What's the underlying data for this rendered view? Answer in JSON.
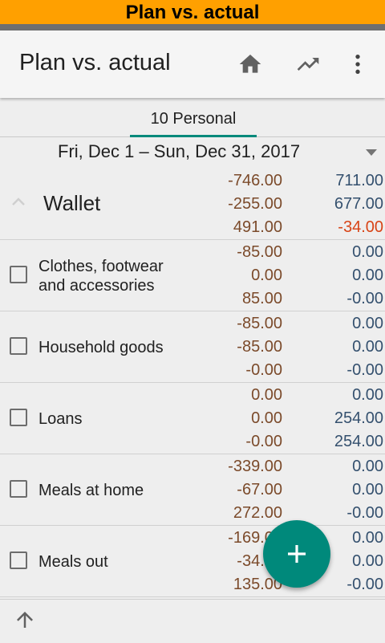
{
  "banner": {
    "title": "Plan vs. actual"
  },
  "appbar": {
    "title": "Plan vs. actual",
    "icons": [
      "home-icon",
      "trending-up-icon",
      "more-vert-icon"
    ]
  },
  "tabs": [
    {
      "label": "10 Personal",
      "selected": true
    }
  ],
  "date_range": {
    "label": "Fri, Dec 1 – Sun, Dec 31, 2017"
  },
  "wallet": {
    "label": "Wallet",
    "col1": [
      "-746.00",
      "-255.00",
      "491.00"
    ],
    "col2": [
      "711.00",
      "677.00",
      "-34.00"
    ]
  },
  "categories": [
    {
      "label_line1": "Clothes, footwear",
      "label_line2": "and accessories",
      "col1": [
        "-85.00",
        "0.00",
        "85.00"
      ],
      "col2": [
        "0.00",
        "0.00",
        "-0.00"
      ]
    },
    {
      "label_line1": "Household goods",
      "label_line2": "",
      "col1": [
        "-85.00",
        "-85.00",
        "-0.00"
      ],
      "col2": [
        "0.00",
        "0.00",
        "-0.00"
      ]
    },
    {
      "label_line1": "Loans",
      "label_line2": "",
      "col1": [
        "0.00",
        "0.00",
        "-0.00"
      ],
      "col2": [
        "0.00",
        "254.00",
        "254.00"
      ]
    },
    {
      "label_line1": "Meals at home",
      "label_line2": "",
      "col1": [
        "-339.00",
        "-67.00",
        "272.00"
      ],
      "col2": [
        "0.00",
        "0.00",
        "-0.00"
      ]
    },
    {
      "label_line1": "Meals out",
      "label_line2": "",
      "col1": [
        "-169.00",
        "-34.00",
        "135.00"
      ],
      "col2": [
        "0.00",
        "0.00",
        "-0.00"
      ]
    }
  ],
  "colors": {
    "accent": "#00897b",
    "banner": "#ffa000",
    "negative": "#d84315",
    "plan": "#7b4a2a",
    "actual": "#34506e"
  }
}
